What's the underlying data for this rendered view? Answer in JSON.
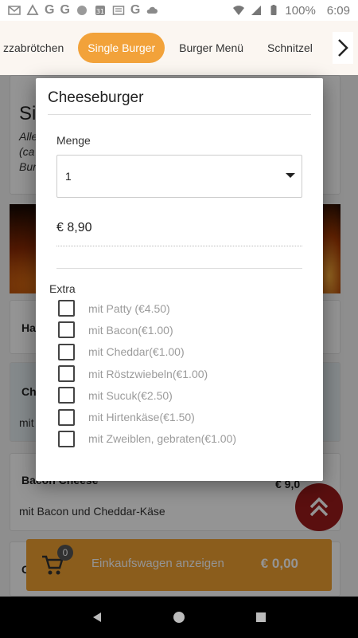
{
  "status_bar": {
    "battery": "100%",
    "time": "6:09"
  },
  "categories": [
    {
      "label": "zzabrötchen",
      "active": false
    },
    {
      "label": "Single Burger",
      "active": true
    },
    {
      "label": "Burger Menü",
      "active": false
    },
    {
      "label": "Schnitzel",
      "active": false
    }
  ],
  "background_page": {
    "section_title_partial": "Si",
    "section_desc_partial": [
      "Alle",
      "(ca",
      "Bur"
    ],
    "item_ha_partial": "Ha",
    "item_ch_partial": "Ch",
    "item_ch_desc_partial": "mit",
    "item_bacon_name": "Bacon Cheese",
    "item_bacon_price": "€ 9,0",
    "item_bacon_desc": "mit Bacon und Cheddar-Käse",
    "item_bottom_partial": "C"
  },
  "dialog": {
    "title": "Cheeseburger",
    "quantity_label": "Menge",
    "quantity_value": "1",
    "price": "€ 8,90",
    "extra_label": "Extra",
    "extras": [
      "mit Patty (€4.50)",
      "mit Bacon(€1.00)",
      "mit Cheddar(€1.00)",
      "mit Röstzwiebeln(€1.00)",
      "mit Sucuk(€2.50)",
      "mit Hirtenkäse(€1.50)",
      "mit Zweiblen, gebraten(€1.00)"
    ]
  },
  "cart": {
    "badge": "0",
    "label": "Einkaufswagen anzeigen",
    "total": "€ 0,00"
  },
  "colors": {
    "accent": "#f2a23a",
    "fab": "#9b1b1b"
  }
}
